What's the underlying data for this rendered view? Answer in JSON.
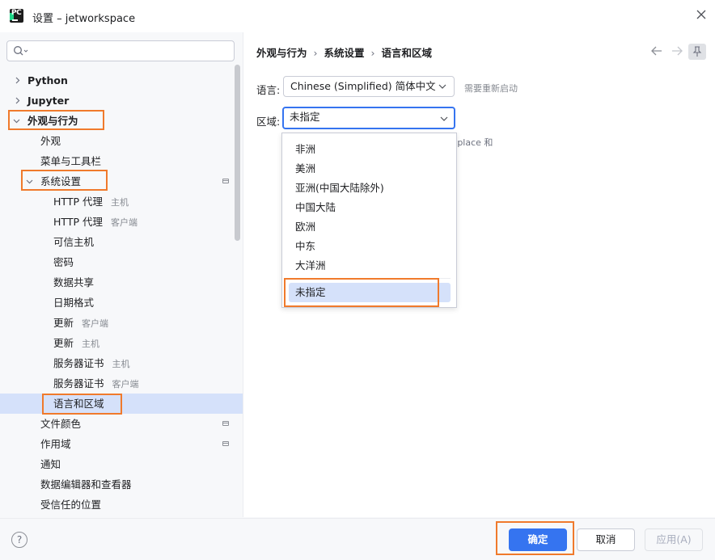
{
  "window": {
    "title": "设置 – jetworkspace"
  },
  "sidebar": {
    "items": [
      {
        "label": "Python",
        "hint": ""
      },
      {
        "label": "Jupyter",
        "hint": ""
      },
      {
        "label": "外观与行为",
        "hint": ""
      },
      {
        "label": "外观",
        "hint": ""
      },
      {
        "label": "菜单与工具栏",
        "hint": ""
      },
      {
        "label": "系统设置",
        "hint": ""
      },
      {
        "label": "HTTP 代理",
        "hint": "主机"
      },
      {
        "label": "HTTP 代理",
        "hint": "客户端"
      },
      {
        "label": "可信主机",
        "hint": ""
      },
      {
        "label": "密码",
        "hint": ""
      },
      {
        "label": "数据共享",
        "hint": ""
      },
      {
        "label": "日期格式",
        "hint": ""
      },
      {
        "label": "更新",
        "hint": "客户端"
      },
      {
        "label": "更新",
        "hint": "主机"
      },
      {
        "label": "服务器证书",
        "hint": "主机"
      },
      {
        "label": "服务器证书",
        "hint": "客户端"
      },
      {
        "label": "语言和区域",
        "hint": ""
      },
      {
        "label": "文件颜色",
        "hint": ""
      },
      {
        "label": "作用域",
        "hint": ""
      },
      {
        "label": "通知",
        "hint": ""
      },
      {
        "label": "数据编辑器和查看器",
        "hint": ""
      },
      {
        "label": "受信任的位置",
        "hint": ""
      }
    ]
  },
  "breadcrumb": {
    "part1": "外观与行为",
    "sep": "›",
    "part2": "系统设置",
    "part3": "语言和区域"
  },
  "form": {
    "language_label": "语言:",
    "language_value": "Chinese (Simplified) 简体中文",
    "restart_note": "需要重新启动",
    "region_label": "区域:",
    "region_value": "未指定",
    "partial_note": "tplace 和"
  },
  "region_options": [
    "非洲",
    "美洲",
    "亚洲(中国大陆除外)",
    "中国大陆",
    "欧洲",
    "中东",
    "大洋洲",
    "未指定"
  ],
  "buttons": {
    "help": "?",
    "ok": "确定",
    "cancel": "取消",
    "apply": "应用(A)"
  },
  "colors": {
    "accent": "#3574f0",
    "selection": "#d5e1fa",
    "highlight_box": "#f07a2c"
  }
}
